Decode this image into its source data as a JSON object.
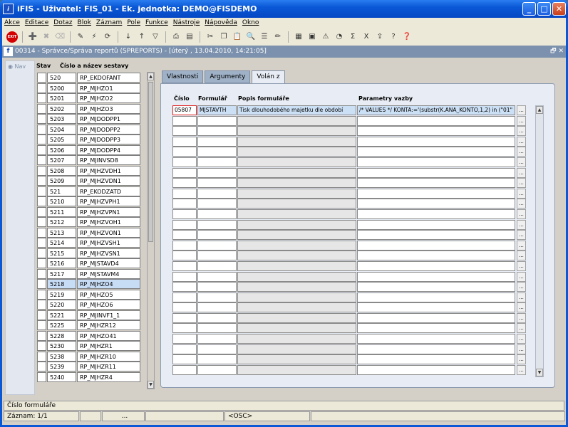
{
  "window": {
    "title": "iFIS - Uživatel: FIS_01 - Ek. jednotka: DEMO@FISDEMO",
    "min": "_",
    "max": "□",
    "close": "✕"
  },
  "menu": [
    "Akce",
    "Editace",
    "Dotaz",
    "Blok",
    "Záznam",
    "Pole",
    "Funkce",
    "Nástroje",
    "Nápověda",
    "Okno"
  ],
  "toolbar": {
    "exit_label": "EXIT"
  },
  "form": {
    "title": "00314 - Správce/Správa reportů (SPREPORTS) - [úterý , 13.04.2010, 14:21:05]",
    "restore": "🗗 ✕"
  },
  "nav": {
    "label": "Nav"
  },
  "reports": {
    "header_stav": "Stav",
    "header_cislo": "Číslo a název sestavy",
    "rows": [
      {
        "num": "520",
        "name": "RP_EKDOFANT"
      },
      {
        "num": "5200",
        "name": "RP_MJHZO1"
      },
      {
        "num": "5201",
        "name": "RP_MJHZO2"
      },
      {
        "num": "5202",
        "name": "RP_MJHZO3"
      },
      {
        "num": "5203",
        "name": "RP_MJDODPP1"
      },
      {
        "num": "5204",
        "name": "RP_MJDODPP2"
      },
      {
        "num": "5205",
        "name": "RP_MJDODPP3"
      },
      {
        "num": "5206",
        "name": "RP_MJDODPP4"
      },
      {
        "num": "5207",
        "name": "RP_MJINVSD8"
      },
      {
        "num": "5208",
        "name": "RP_MJHZVDH1"
      },
      {
        "num": "5209",
        "name": "RP_MJHZVDN1"
      },
      {
        "num": "521",
        "name": "RP_EKODZATD"
      },
      {
        "num": "5210",
        "name": "RP_MJHZVPH1"
      },
      {
        "num": "5211",
        "name": "RP_MJHZVPN1"
      },
      {
        "num": "5212",
        "name": "RP_MJHZVOH1"
      },
      {
        "num": "5213",
        "name": "RP_MJHZVON1"
      },
      {
        "num": "5214",
        "name": "RP_MJHZVSH1"
      },
      {
        "num": "5215",
        "name": "RP_MJHZVSN1"
      },
      {
        "num": "5216",
        "name": "RP_MJSTAVD4"
      },
      {
        "num": "5217",
        "name": "RP_MJSTAVM4"
      },
      {
        "num": "5218",
        "name": "RP_MJHZO4"
      },
      {
        "num": "5219",
        "name": "RP_MJHZO5"
      },
      {
        "num": "5220",
        "name": "RP_MJHZO6"
      },
      {
        "num": "5221",
        "name": "RP_MJINVF1_1"
      },
      {
        "num": "5225",
        "name": "RP_MJHZR12"
      },
      {
        "num": "5228",
        "name": "RP_MJHZO41"
      },
      {
        "num": "5230",
        "name": "RP_MJHZR1"
      },
      {
        "num": "5238",
        "name": "RP_MJHZR10"
      },
      {
        "num": "5239",
        "name": "RP_MJHZR11"
      },
      {
        "num": "5240",
        "name": "RP_MJHZR4"
      }
    ],
    "selected_index": 20
  },
  "tabs": [
    "Vlastnosti",
    "Argumenty",
    "Volán z"
  ],
  "active_tab": 2,
  "grid": {
    "headers": {
      "cislo": "Číslo",
      "formular": "Formulář",
      "popis": "Popis formuláře",
      "parametry": "Parametry vazby"
    },
    "rows": [
      {
        "cislo": "05807",
        "formular": "MJSTAVTH",
        "popis": "Tisk dlouhodobého majetku dle období",
        "parametry": "/* VALUES */ KONTA:='(substr(K.ANA_KONTO,1,2) in (\"01\""
      }
    ],
    "empty_rows": 25,
    "button_label": "..."
  },
  "status": {
    "field_hint": "Číslo formuláře",
    "record": "Záznam: 1/1",
    "dots": "...",
    "mode": "<OSC>"
  }
}
